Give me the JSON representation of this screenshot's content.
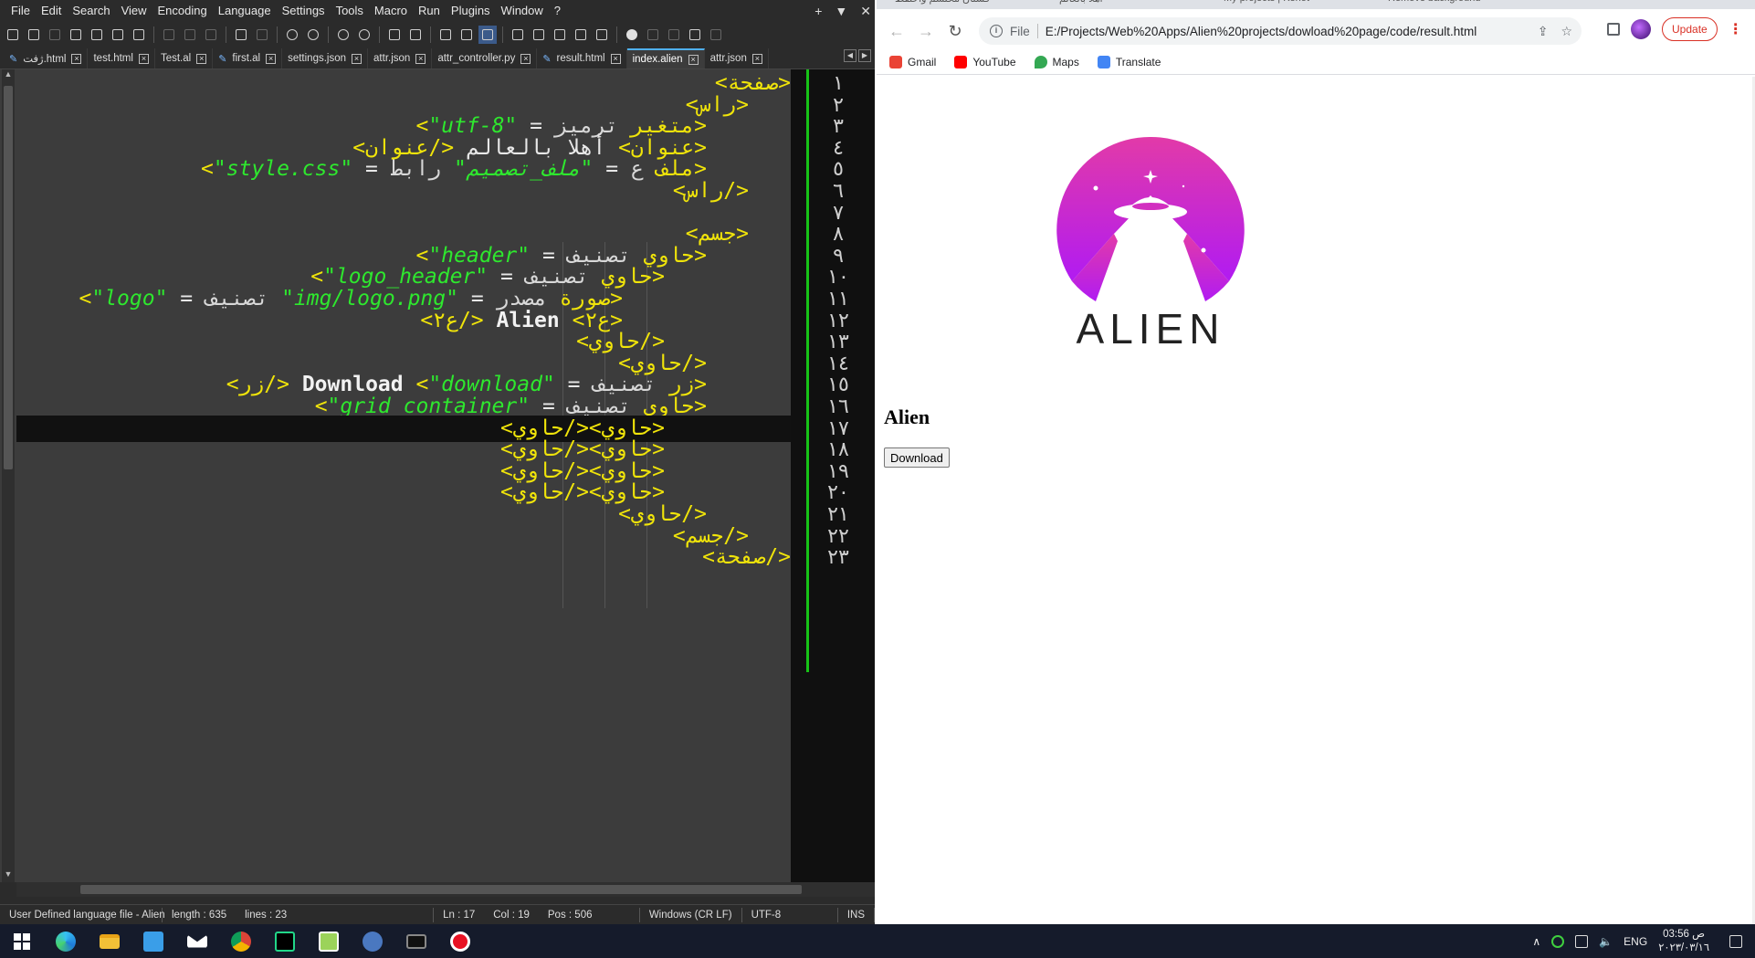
{
  "npp": {
    "menu": [
      "File",
      "Edit",
      "Search",
      "View",
      "Encoding",
      "Language",
      "Settings",
      "Tools",
      "Macro",
      "Run",
      "Plugins",
      "Window",
      "?"
    ],
    "tabs": [
      {
        "label": "ژفت.html",
        "modified": true
      },
      {
        "label": "test.html",
        "modified": false
      },
      {
        "label": "Test.al",
        "modified": false
      },
      {
        "label": "first.al",
        "modified": true
      },
      {
        "label": "settings.json",
        "modified": false
      },
      {
        "label": "attr.json",
        "modified": false
      },
      {
        "label": "attr_controller.py",
        "modified": false
      },
      {
        "label": "result.html",
        "modified": true
      },
      {
        "label": "index.alien",
        "modified": false,
        "active": true
      },
      {
        "label": "attr.json",
        "modified": false
      }
    ],
    "line_numbers": [
      "١",
      "٢",
      "٣",
      "٤",
      "٥",
      "٦",
      "٧",
      "٨",
      "٩",
      "١٠",
      "١١",
      "١٢",
      "١٣",
      "١٤",
      "١٥",
      "١٦",
      "١٧",
      "١٨",
      "١٩",
      "٢٠",
      "٢١",
      "٢٢",
      "٢٣"
    ],
    "current_line": 17,
    "code": [
      [
        {
          "t": "<صفحة>",
          "c": "tag"
        }
      ],
      [
        {
          "t": "<راس>",
          "c": "tag"
        }
      ],
      [
        {
          "t": "<متغير ",
          "c": "tag"
        },
        {
          "t": "ترميز",
          "c": "attr"
        },
        {
          "t": " = ",
          "c": "op"
        },
        {
          "t": "\"utf-8\"",
          "c": "str"
        },
        {
          "t": ">",
          "c": "tag"
        }
      ],
      [
        {
          "t": "<عنوان>",
          "c": "tag"
        },
        {
          "t": " أهلا بالعالم ",
          "c": "txt"
        },
        {
          "t": "</عنوان>",
          "c": "tag"
        }
      ],
      [
        {
          "t": "<ملف ",
          "c": "tag"
        },
        {
          "t": "ع",
          "c": "attr"
        },
        {
          "t": " = ",
          "c": "op"
        },
        {
          "t": "\"ملف_تصميم\"",
          "c": "str"
        },
        {
          "t": " رابط",
          "c": "attr"
        },
        {
          "t": " = ",
          "c": "op"
        },
        {
          "t": "\"style.css\"",
          "c": "str"
        },
        {
          "t": ">",
          "c": "tag"
        }
      ],
      [
        {
          "t": "</راس>",
          "c": "tag"
        }
      ],
      [],
      [
        {
          "t": "<جسم>",
          "c": "tag"
        }
      ],
      [
        {
          "t": "<حاوي ",
          "c": "tag"
        },
        {
          "t": "تصنيف",
          "c": "attr"
        },
        {
          "t": " = ",
          "c": "op"
        },
        {
          "t": "\"header\"",
          "c": "str"
        },
        {
          "t": ">",
          "c": "tag"
        }
      ],
      [
        {
          "t": "<حاوي ",
          "c": "tag"
        },
        {
          "t": "تصنيف",
          "c": "attr"
        },
        {
          "t": " = ",
          "c": "op"
        },
        {
          "t": "\"logo_header\"",
          "c": "str"
        },
        {
          "t": ">",
          "c": "tag"
        }
      ],
      [
        {
          "t": "<صورة ",
          "c": "tag"
        },
        {
          "t": "مصدر",
          "c": "attr"
        },
        {
          "t": " = ",
          "c": "op"
        },
        {
          "t": "\"img/logo.png\"",
          "c": "str"
        },
        {
          "t": " تصنيف",
          "c": "attr"
        },
        {
          "t": " = ",
          "c": "op"
        },
        {
          "t": "\"logo\"",
          "c": "str"
        },
        {
          "t": ">",
          "c": "tag"
        }
      ],
      [
        {
          "t": "<ع٢>",
          "c": "tag"
        },
        {
          "t": " Alien ",
          "c": "bold"
        },
        {
          "t": "</ع٢>",
          "c": "tag"
        }
      ],
      [
        {
          "t": "</حاوي>",
          "c": "tag"
        }
      ],
      [
        {
          "t": "</حاوي>",
          "c": "tag"
        }
      ],
      [
        {
          "t": "<زر ",
          "c": "tag"
        },
        {
          "t": "تصنيف",
          "c": "attr"
        },
        {
          "t": " = ",
          "c": "op"
        },
        {
          "t": "\"download\"",
          "c": "str"
        },
        {
          "t": ">",
          "c": "tag"
        },
        {
          "t": " Download ",
          "c": "bold"
        },
        {
          "t": "</زر>",
          "c": "tag"
        }
      ],
      [
        {
          "t": "<حاوي ",
          "c": "tag"
        },
        {
          "t": "تصنيف",
          "c": "attr"
        },
        {
          "t": " = ",
          "c": "op"
        },
        {
          "t": "\"grid_container\"",
          "c": "str"
        },
        {
          "t": ">",
          "c": "tag"
        }
      ],
      [
        {
          "t": "<حاوي></حاوي>",
          "c": "tag"
        }
      ],
      [
        {
          "t": "<حاوي></حاوي>",
          "c": "tag"
        }
      ],
      [
        {
          "t": "<حاوي></حاوي>",
          "c": "tag"
        }
      ],
      [
        {
          "t": "<حاوي></حاوي>",
          "c": "tag"
        }
      ],
      [
        {
          "t": "</حاوي>",
          "c": "tag"
        }
      ],
      [
        {
          "t": "</جسم>",
          "c": "tag"
        }
      ],
      [
        {
          "t": "</صفحة>",
          "c": "tag"
        }
      ]
    ],
    "status": {
      "lang": "User Defined language file - Alien",
      "length": "length : 635",
      "lines": "lines : 23",
      "ln": "Ln : 17",
      "col": "Col : 19",
      "pos": "Pos : 506",
      "eol": "Windows (CR LF)",
      "enc": "UTF-8",
      "ins": "INS"
    }
  },
  "chrome": {
    "tab_titles": [
      "فستان محتشم واحتفظ",
      "أهلا بالعالم",
      "My projects | Kenot",
      "Remove background"
    ],
    "address": {
      "scheme": "File",
      "url": "E:/Projects/Web%20Apps/Alien%20projects/dowload%20page/code/result.html"
    },
    "update_label": "Update",
    "bookmarks": [
      {
        "label": "Gmail",
        "icon": "gmail-icon"
      },
      {
        "label": "YouTube",
        "icon": "youtube-icon"
      },
      {
        "label": "Maps",
        "icon": "maps-icon"
      },
      {
        "label": "Translate",
        "icon": "translate-icon"
      }
    ],
    "page": {
      "logo_text": "ALIEN",
      "heading": "Alien",
      "button": "Download"
    }
  },
  "taskbar": {
    "lang": "ENG",
    "time": "03:56 ص",
    "date": "٢٠٢٣/٠٣/١٦"
  },
  "colors": {
    "tag": "#f0e40a",
    "attr": "#d8d8d8",
    "op": "#e8e8e8",
    "str": "#2ee82e",
    "txt": "#e8e8e8",
    "bold": "#f2f2f2",
    "linenum_bg": "#101010",
    "green_bar": "#17c217",
    "logo_gradient_top": "#e23aa8",
    "logo_gradient_bottom": "#b11bf2"
  }
}
